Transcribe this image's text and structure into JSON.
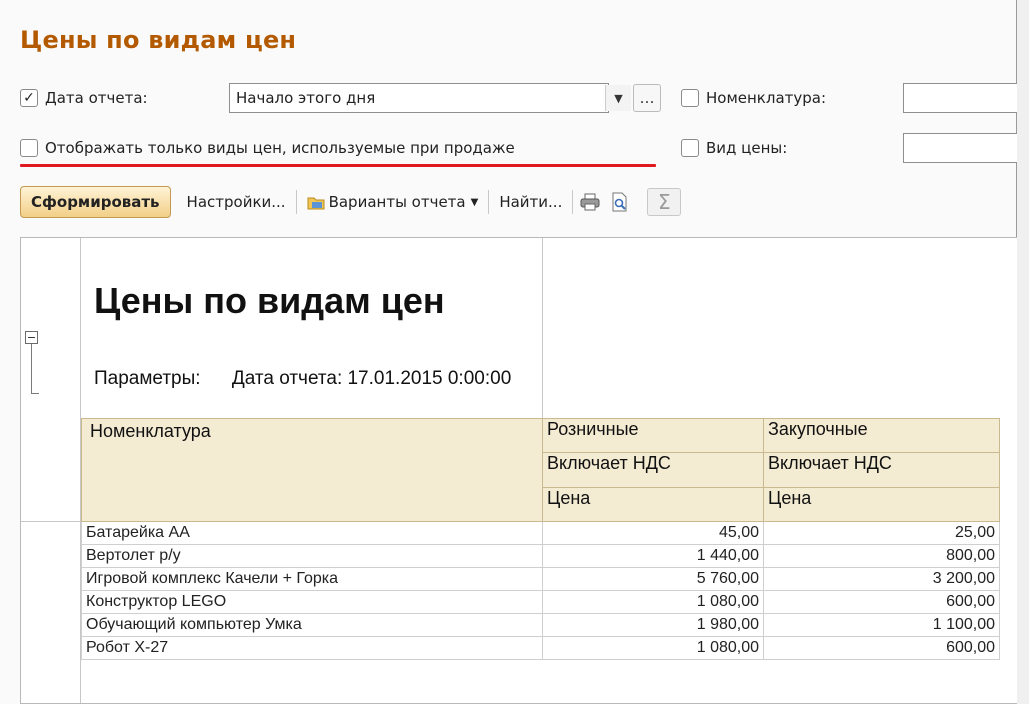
{
  "window": {
    "title": "Цены по видам цен"
  },
  "filters": {
    "date": {
      "label": "Дата отчета:",
      "checked": true,
      "value": "Начало этого дня"
    },
    "nomenclature": {
      "label": "Номенклатура:",
      "checked": false,
      "value": ""
    },
    "only_sales": {
      "label": "Отображать только виды цен, используемые при продаже",
      "checked": false
    },
    "price_type": {
      "label": "Вид цены:",
      "checked": false,
      "value": ""
    }
  },
  "toolbar": {
    "generate": "Сформировать",
    "settings": "Настройки...",
    "variants": "Варианты отчета",
    "find": "Найти..."
  },
  "report": {
    "title": "Цены по видам цен",
    "params_label": "Параметры:",
    "params_value": "Дата отчета: 17.01.2015 0:00:00",
    "header": {
      "nomenclature": "Номенклатура",
      "col1_type": "Розничные",
      "col2_type": "Закупочные",
      "col1_vat": "Включает НДС",
      "col2_vat": "Включает НДС",
      "col1_unit": "Цена",
      "col2_unit": "Цена"
    },
    "rows": [
      {
        "name": "Батарейка АА",
        "retail": "45,00",
        "purchase": "25,00"
      },
      {
        "name": "Вертолет р/у",
        "retail": "1 440,00",
        "purchase": "800,00"
      },
      {
        "name": "Игровой комплекс Качели + Горка",
        "retail": "5 760,00",
        "purchase": "3 200,00"
      },
      {
        "name": "Конструктор LEGO",
        "retail": "1 080,00",
        "purchase": "600,00"
      },
      {
        "name": "Обучающий компьютер Умка",
        "retail": "1 980,00",
        "purchase": "1 100,00"
      },
      {
        "name": "Робот Х-27",
        "retail": "1 080,00",
        "purchase": "600,00"
      }
    ]
  },
  "colors": {
    "title": "#b35a00",
    "underline": "#e0181f",
    "header_bg": "#f4ebd3"
  }
}
